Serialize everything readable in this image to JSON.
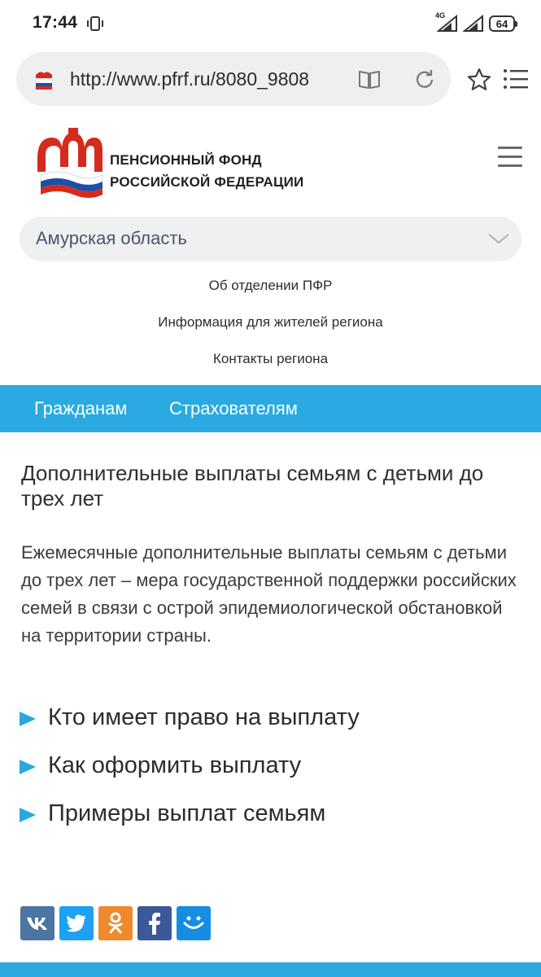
{
  "status_bar": {
    "time": "17:44",
    "network": "4G",
    "battery": "64"
  },
  "browser": {
    "url": "http://www.pfrf.ru/8080_9808",
    "icons": [
      "site-favicon",
      "reader-mode-icon",
      "reload-icon",
      "star-icon",
      "menu-list-icon"
    ]
  },
  "header": {
    "org_line1": "ПЕНСИОННЫЙ ФОНД",
    "org_line2": "РОССИЙСКОЙ ФЕДЕРАЦИИ"
  },
  "region": {
    "selected": "Амурская область"
  },
  "sub_links": [
    {
      "label": "Об отделении  ПФР"
    },
    {
      "label": "Информация для жителей региона"
    },
    {
      "label": "Контакты региона"
    }
  ],
  "main_nav": [
    {
      "label": "Гражданам"
    },
    {
      "label": "Страхователям"
    }
  ],
  "content": {
    "title": "Дополнительные выплаты семьям с детьми до трех лет",
    "intro": "Ежемесячные дополнительные выплаты семьям с детьми до трех лет – мера государственной поддержки российских семей в связи с острой эпидемиологической обстановкой на территории страны.",
    "accordion": [
      {
        "label": "Кто имеет право на выплату"
      },
      {
        "label": "Как оформить выплату"
      },
      {
        "label": "Примеры выплат семьям"
      }
    ]
  },
  "share": {
    "buttons": [
      "vk",
      "twitter",
      "odnoklassniki",
      "facebook",
      "moi-mir"
    ]
  },
  "colors": {
    "accent_blue": "#2aaae0",
    "logo_red": "#d52b1e",
    "vk": "#4c75a3",
    "twitter": "#1da1f2",
    "ok": "#ef8a2c",
    "facebook": "#3b5998",
    "mail": "#168de2"
  }
}
